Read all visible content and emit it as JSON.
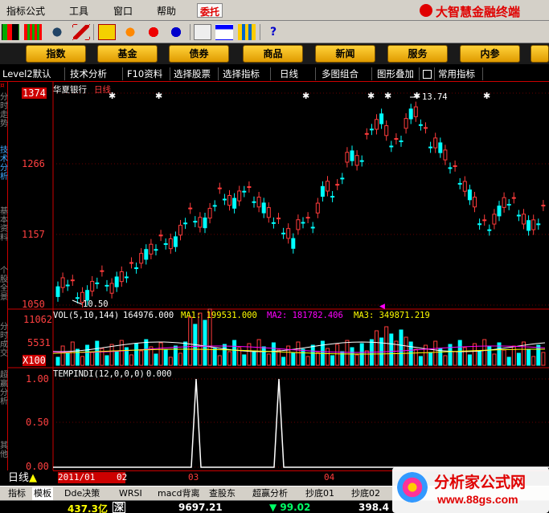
{
  "menubar": {
    "items": [
      "指标",
      "公式",
      "工具",
      "窗口",
      "帮助"
    ],
    "entrust": "委托",
    "brand": "大智慧金融终端"
  },
  "categories": [
    "指数",
    "基金",
    "债券",
    "商品",
    "新闻",
    "服务",
    "内参"
  ],
  "tabs": [
    "Level2默认",
    "技术分析",
    "F10资料",
    "选择股票",
    "选择指标",
    "日线",
    "多图组合",
    "图形叠加",
    "常用指标"
  ],
  "sidebar": [
    "分时走势",
    "技术分析",
    "基本资料",
    "个股全景"
  ],
  "chart": {
    "stock_name": "华夏银行",
    "period": "日线",
    "price_max_label": "13.74",
    "price_min_label": "10.50",
    "price_axis": [
      "1374",
      "1266",
      "1157",
      "1050"
    ],
    "vol_indicator": "VOL(5,10,144)",
    "vol_value": "164976.000",
    "ma1": "MA1: 199531.000",
    "ma2": "MA2: 181782.406",
    "ma3": "MA3: 349871.219",
    "vol_axis": [
      "11062",
      "5531"
    ],
    "vol_unit": "X100",
    "sub_indicator": "TEMPINDI(12,0,0,0)",
    "sub_value": "0.000",
    "sub_axis": [
      "1.00",
      "0.50",
      "0.00"
    ],
    "colors": {
      "up": "#ff3b3b",
      "down": "#00ffff",
      "ma1": "#ffffff",
      "ma2": "#ff00ff",
      "ma3": "#ffff00"
    }
  },
  "datebar": {
    "period": "日线",
    "dates": [
      "2011/01",
      "02",
      "03",
      "04"
    ]
  },
  "bottom_tabs": [
    "指标",
    "模板",
    "Dde决策",
    "WRSI",
    "macd背离",
    "查股东",
    "超赢分析",
    "抄底01",
    "抄底02"
  ],
  "status": {
    "v1": "437.3亿",
    "label2": "深",
    "v2": "9697.21",
    "v3": "▼ 99.02",
    "v4": "398.4"
  },
  "watermark": {
    "text": "分析家公式网",
    "url": "www.88gs.com"
  }
}
